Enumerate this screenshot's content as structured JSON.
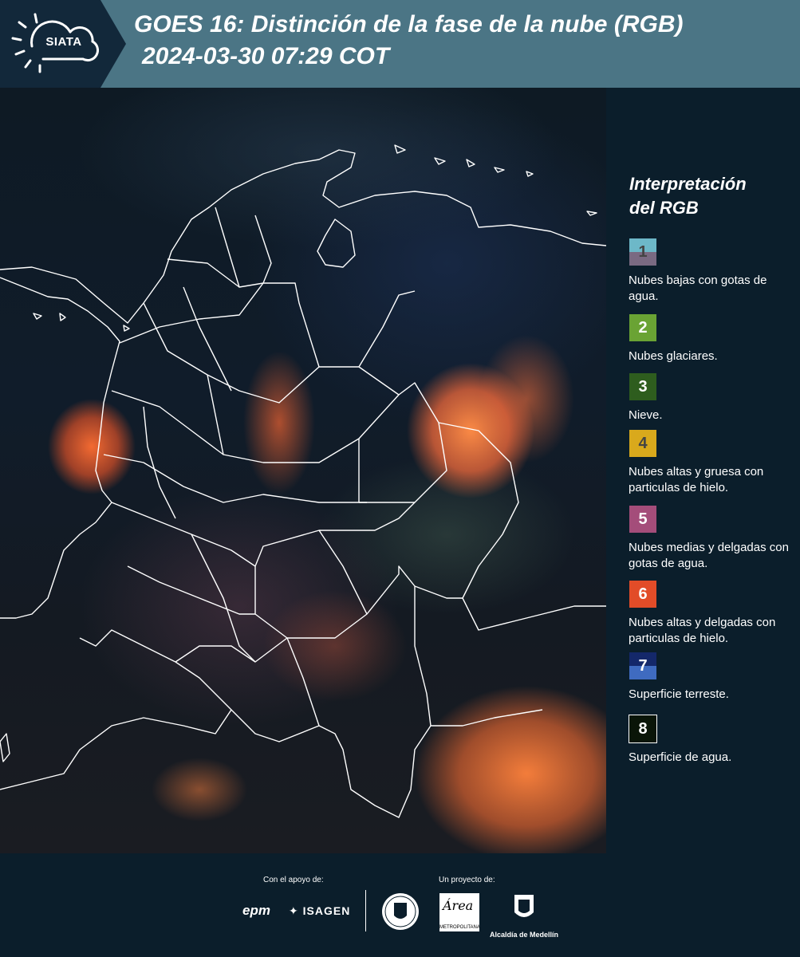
{
  "header": {
    "logo_text": "SIATA",
    "title_line1": "GOES 16: Distinción de la fase de la nube (RGB)",
    "title_line2": "2024-03-30 07:29 COT"
  },
  "legend": {
    "title_line1": "Interpretación",
    "title_line2": "del RGB",
    "items": [
      {
        "number": "1",
        "label": "Nubes bajas con gotas de agua.",
        "color_top": "#6db8c8",
        "color_bottom": "#7a6a82",
        "text_color": "#444444"
      },
      {
        "number": "2",
        "label": "Nubes glaciares.",
        "color_top": "#6aa334",
        "color_bottom": "#6aa334",
        "text_color": "#ffffff"
      },
      {
        "number": "3",
        "label": "Nieve.",
        "color_top": "#2e5d1e",
        "color_bottom": "#2e5d1e",
        "text_color": "#ffffff"
      },
      {
        "number": "4",
        "label": "Nubes altas y gruesa con particulas de hielo.",
        "color_top": "#d9a91c",
        "color_bottom": "#d9a91c",
        "text_color": "#444444"
      },
      {
        "number": "5",
        "label": "Nubes medias y delgadas con gotas de agua.",
        "color_top": "#a44d7a",
        "color_bottom": "#a44d7a",
        "text_color": "#ffffff"
      },
      {
        "number": "6",
        "label": "Nubes altas y delgadas con particulas de hielo.",
        "color_top": "#e24c28",
        "color_bottom": "#e24c28",
        "text_color": "#ffffff"
      },
      {
        "number": "7",
        "label": "Superficie terreste.",
        "color_top": "#14286a",
        "color_bottom": "#3f6bc0",
        "text_color": "#ffffff"
      },
      {
        "number": "8",
        "label": "Superficie de agua.",
        "color_top": "#0a1508",
        "color_bottom": "#0a1508",
        "text_color": "#ffffff"
      }
    ]
  },
  "footer": {
    "support_label": "Con el apoyo de:",
    "project_label": "Un proyecto de:",
    "epm": "epm",
    "isagen": "ISAGEN",
    "area_name": "Área",
    "area_sub": "METROPOLITANA",
    "alcaldia": "Alcaldía de Medellín"
  }
}
